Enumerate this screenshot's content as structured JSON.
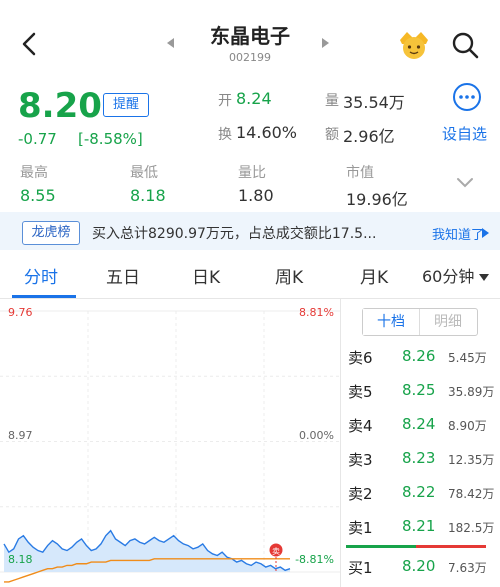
{
  "header": {
    "name": "东晶电子",
    "code": "002199"
  },
  "quote": {
    "price": "8.20",
    "remind": "提醒",
    "change": "-0.77",
    "change_pct": "[-8.58%]",
    "open_label": "开",
    "open": "8.24",
    "vol_label": "量",
    "volume": "35.54万",
    "turn_label": "换",
    "turnover": "14.60%",
    "amt_label": "额",
    "amount": "2.96亿",
    "add_fav": "设自选"
  },
  "stats": [
    {
      "label": "最高",
      "value": "8.55"
    },
    {
      "label": "最低",
      "value": "8.18"
    },
    {
      "label": "量比",
      "value": "1.80"
    },
    {
      "label": "市值",
      "value": "19.96亿"
    }
  ],
  "banner": {
    "tag": "龙虎榜",
    "text": "买入总计8290.97万元，占总成交额比17.5...",
    "link": "我知道了"
  },
  "tabs": [
    "分时",
    "五日",
    "日K",
    "周K",
    "月K",
    "60分钟"
  ],
  "chart_data": {
    "type": "line",
    "y_high_label": "9.76",
    "y_mid_label": "8.97",
    "y_low_label": "8.18",
    "pct_high_label": "8.81%",
    "pct_mid_label": "0.00%",
    "pct_low_label": "-8.81%",
    "ylim": [
      8.18,
      9.76
    ],
    "prev_close": 8.97,
    "marker_label": "卖",
    "series": [
      {
        "values": [
          8.35,
          8.3,
          8.32,
          8.38,
          8.4,
          8.36,
          8.33,
          8.31,
          8.3,
          8.34,
          8.37,
          8.35,
          8.32,
          8.31,
          8.33,
          8.36,
          8.38,
          8.34,
          8.31,
          8.32,
          8.35,
          8.4,
          8.43,
          8.38,
          8.36,
          8.34,
          8.37,
          8.38,
          8.36,
          8.35,
          8.37,
          8.39,
          8.37,
          8.36,
          8.38,
          8.4,
          8.37,
          8.35,
          8.34,
          8.32,
          8.33,
          8.35,
          8.31,
          8.29,
          8.28,
          8.3,
          8.27,
          8.26,
          8.24,
          8.25,
          8.23,
          8.22,
          8.24,
          8.23,
          8.21,
          8.22,
          8.2,
          8.21,
          8.19,
          8.2
        ]
      },
      {
        "values": [
          8.12,
          8.12,
          8.13,
          8.14,
          8.15,
          8.16,
          8.17,
          8.18,
          8.19,
          8.2,
          8.2,
          8.21,
          8.21,
          8.22,
          8.22,
          8.23,
          8.23,
          8.23,
          8.24,
          8.24,
          8.24,
          8.24,
          8.25,
          8.25,
          8.25,
          8.25,
          8.25,
          8.25,
          8.25,
          8.25,
          8.25,
          8.26,
          8.26,
          8.26,
          8.26,
          8.26,
          8.26,
          8.26,
          8.26,
          8.26,
          8.26,
          8.26,
          8.26,
          8.26,
          8.26,
          8.26,
          8.26,
          8.26,
          8.26,
          8.26,
          8.26,
          8.26,
          8.26,
          8.26,
          8.26,
          8.26,
          8.26,
          8.26,
          8.26,
          8.26
        ]
      }
    ]
  },
  "orderbook": {
    "tabs": [
      "十档",
      "明细"
    ],
    "rows": [
      {
        "label": "卖6",
        "price": "8.26",
        "vol": "5.45万"
      },
      {
        "label": "卖5",
        "price": "8.25",
        "vol": "35.89万"
      },
      {
        "label": "卖4",
        "price": "8.24",
        "vol": "8.90万"
      },
      {
        "label": "卖3",
        "price": "8.23",
        "vol": "12.35万"
      },
      {
        "label": "卖2",
        "price": "8.22",
        "vol": "78.42万"
      },
      {
        "label": "卖1",
        "price": "8.21",
        "vol": "182.5万"
      },
      {
        "label": "买1",
        "price": "8.20",
        "vol": "7.63万"
      }
    ]
  },
  "colors": {
    "down": "#17a34a",
    "up": "#e53935",
    "accent": "#1a73e8",
    "avg_line": "#f08c1a",
    "price_line": "#2a7be4"
  }
}
